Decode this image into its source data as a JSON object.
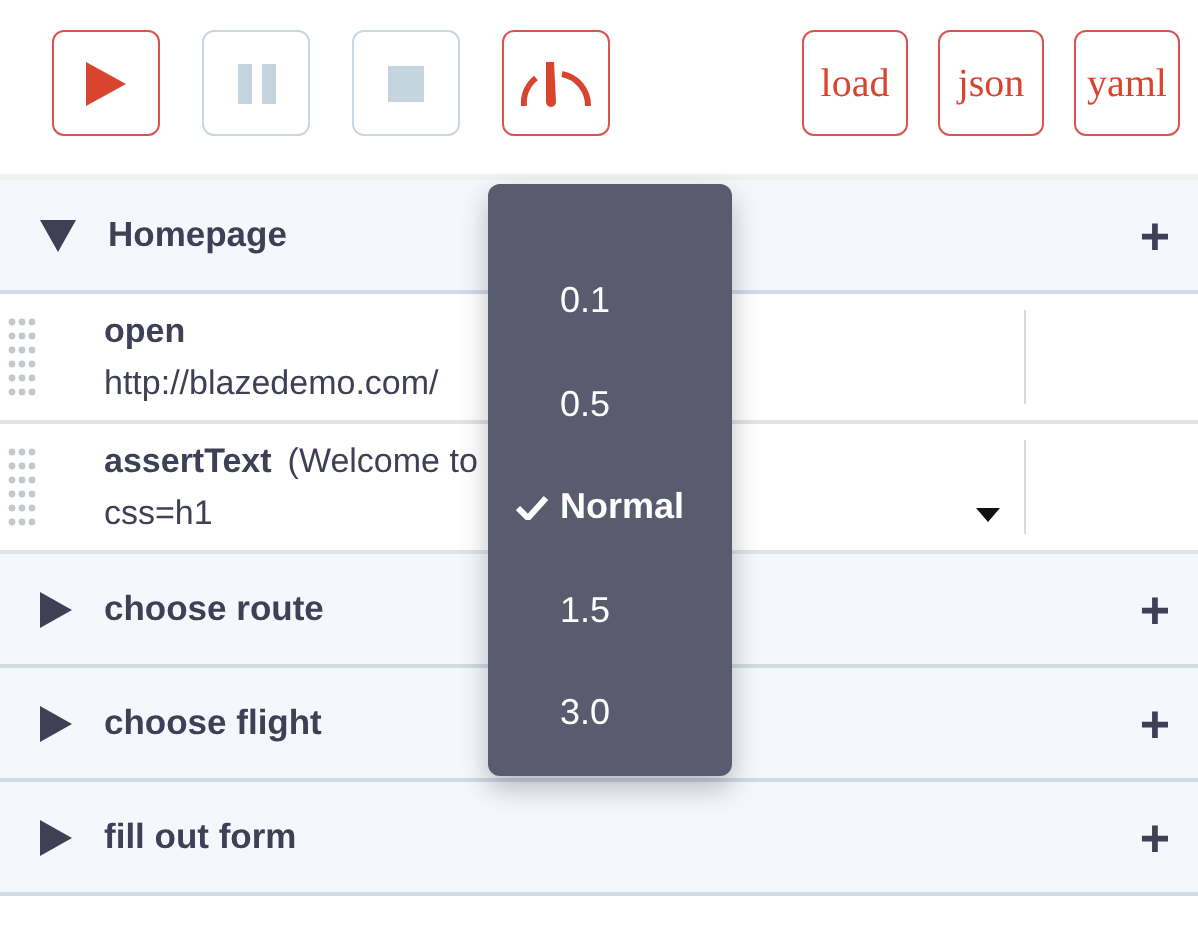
{
  "toolbar": {
    "buttons": [
      {
        "kind": "play",
        "disabled": false
      },
      {
        "kind": "pause",
        "disabled": true
      },
      {
        "kind": "stop",
        "disabled": true
      },
      {
        "kind": "speed",
        "disabled": false
      }
    ],
    "file_buttons": [
      "load",
      "json",
      "yaml"
    ]
  },
  "groups": [
    {
      "title": "Homepage",
      "expanded": true,
      "add": "+",
      "steps": [
        {
          "command": "open",
          "target": "http://blazedemo.com/",
          "has_dropdown": false
        },
        {
          "command": "assertText",
          "value": "(Welcome to",
          "target": "css=h1",
          "has_dropdown": true
        }
      ]
    },
    {
      "title": "choose route",
      "expanded": false,
      "add": "+"
    },
    {
      "title": "choose flight",
      "expanded": false,
      "add": "+"
    },
    {
      "title": "fill out form",
      "expanded": false,
      "add": "+"
    }
  ],
  "speed_menu": {
    "items": [
      {
        "label": "0.1",
        "selected": false
      },
      {
        "label": "0.5",
        "selected": false
      },
      {
        "label": "Normal",
        "selected": true
      },
      {
        "label": "1.5",
        "selected": false
      },
      {
        "label": "3.0",
        "selected": false
      }
    ]
  }
}
